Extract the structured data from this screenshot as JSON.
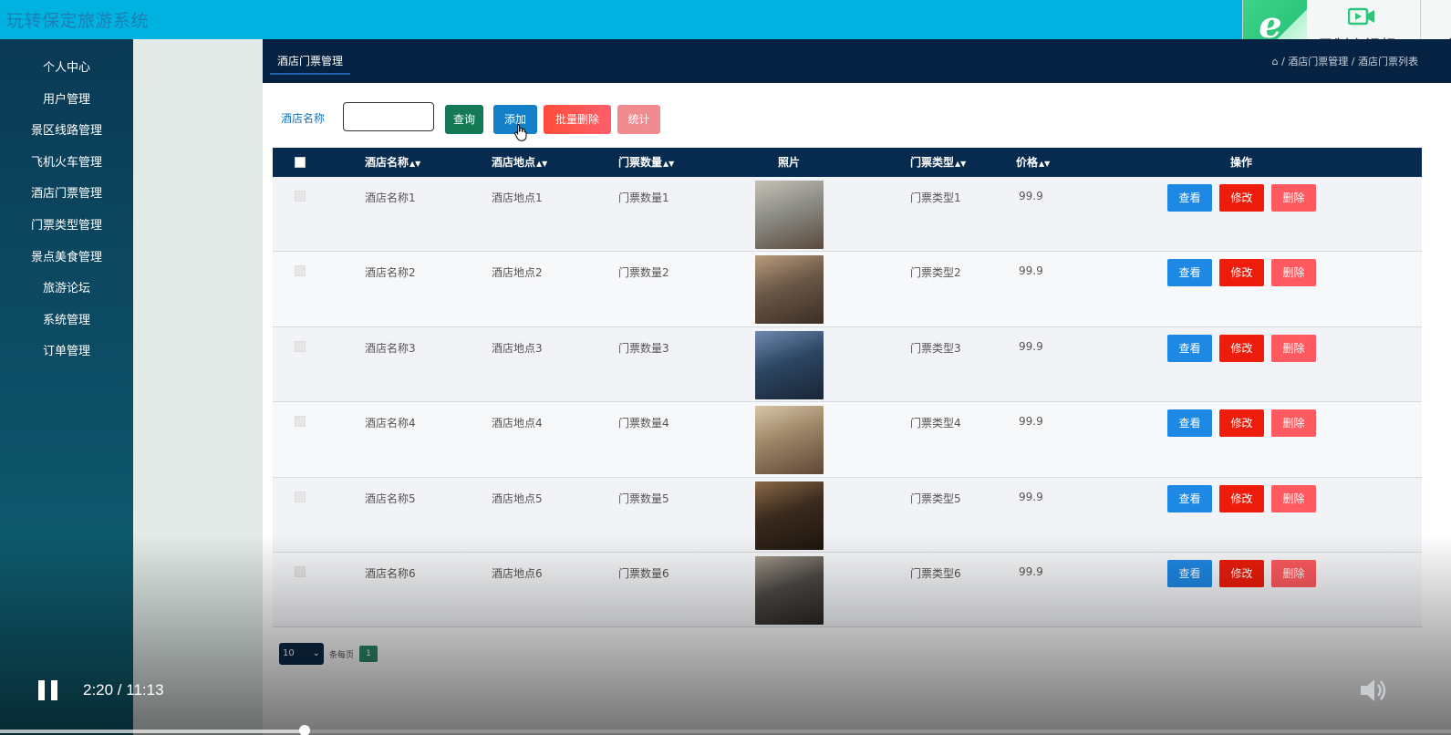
{
  "app": {
    "title": "玩转保定旅游系统"
  },
  "recorder": {
    "label": "录制小视频",
    "extra": "小"
  },
  "sidebar": {
    "items": [
      {
        "label": "个人中心"
      },
      {
        "label": "用户管理"
      },
      {
        "label": "景区线路管理"
      },
      {
        "label": "飞机火车管理"
      },
      {
        "label": "酒店门票管理"
      },
      {
        "label": "门票类型管理"
      },
      {
        "label": "景点美食管理"
      },
      {
        "label": "旅游论坛"
      },
      {
        "label": "系统管理"
      },
      {
        "label": "订单管理"
      }
    ]
  },
  "header": {
    "tab": "酒店门票管理",
    "breadcrumb": "/ 酒店门票管理 / 酒店门票列表"
  },
  "search": {
    "label": "酒店名称",
    "value": "",
    "placeholder": ""
  },
  "toolbar": {
    "query": "查询",
    "add": "添加",
    "bulk_delete": "批量删除",
    "stats": "统计"
  },
  "table": {
    "columns": [
      "酒店名称",
      "酒店地点",
      "门票数量",
      "照片",
      "门票类型",
      "价格",
      "操作"
    ],
    "rows": [
      {
        "name": "酒店名称1",
        "location": "酒店地点1",
        "count": "门票数量1",
        "type": "门票类型1",
        "price": "99.9"
      },
      {
        "name": "酒店名称2",
        "location": "酒店地点2",
        "count": "门票数量2",
        "type": "门票类型2",
        "price": "99.9"
      },
      {
        "name": "酒店名称3",
        "location": "酒店地点3",
        "count": "门票数量3",
        "type": "门票类型3",
        "price": "99.9"
      },
      {
        "name": "酒店名称4",
        "location": "酒店地点4",
        "count": "门票数量4",
        "type": "门票类型4",
        "price": "99.9"
      },
      {
        "name": "酒店名称5",
        "location": "酒店地点5",
        "count": "门票数量5",
        "type": "门票类型5",
        "price": "99.9"
      },
      {
        "name": "酒店名称6",
        "location": "酒店地点6",
        "count": "门票数量6",
        "type": "门票类型6",
        "price": "99.9"
      }
    ],
    "actions": {
      "view": "查看",
      "edit": "修改",
      "delete": "删除"
    }
  },
  "pager": {
    "page_size": "10",
    "per_page_label": "条每页",
    "current_page": "1"
  },
  "video": {
    "time": "2:20 / 11:13",
    "progress": 0.21
  },
  "colors": {
    "accent": "#00b2e0",
    "header_dark": "#052243",
    "view": "#1e88e5",
    "edit": "#ee1c0b",
    "delete": "#ff5a5f"
  }
}
